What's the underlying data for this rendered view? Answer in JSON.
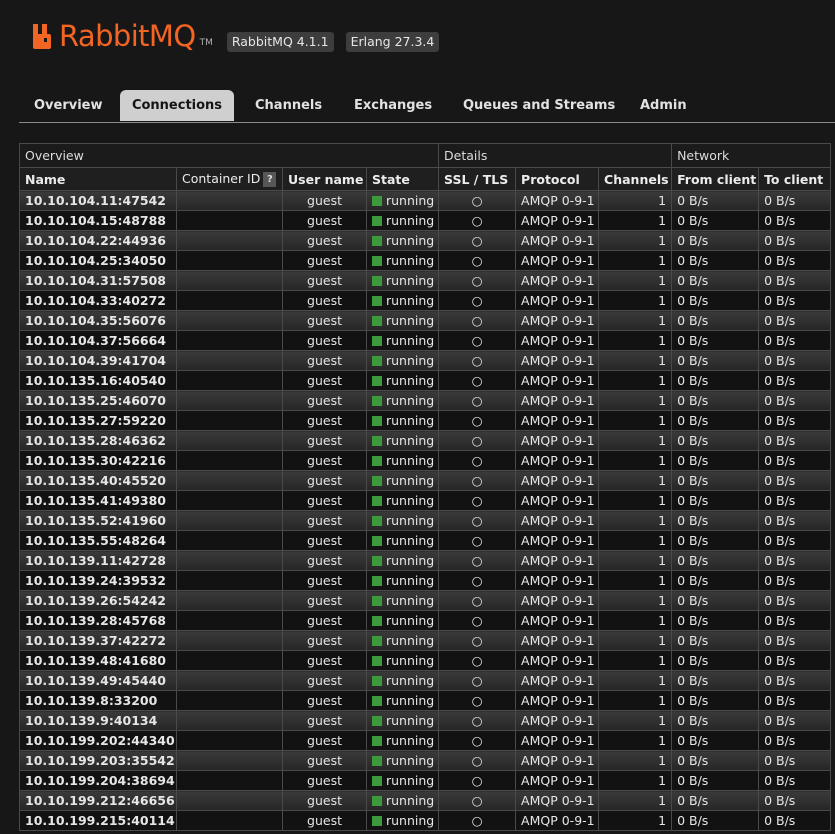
{
  "app": {
    "name": "RabbitMQ",
    "tm": "TM",
    "version_badge": "RabbitMQ 4.1.1",
    "erlang_badge": "Erlang 27.3.4",
    "brand_color": "#f26522"
  },
  "tabs": [
    {
      "label": "Overview",
      "active": false
    },
    {
      "label": "Connections",
      "active": true
    },
    {
      "label": "Channels",
      "active": false
    },
    {
      "label": "Exchanges",
      "active": false
    },
    {
      "label": "Queues and Streams",
      "active": false
    },
    {
      "label": "Admin",
      "active": false
    }
  ],
  "table": {
    "groups": [
      "Overview",
      "Details",
      "Network"
    ],
    "columns": [
      "Name",
      "Container ID",
      "User name",
      "State",
      "SSL / TLS",
      "Protocol",
      "Channels",
      "From client",
      "To client"
    ],
    "help_label": "?",
    "rows": [
      {
        "name": "10.10.104.11:47542",
        "user": "guest",
        "state": "running",
        "ssl": "○",
        "protocol": "AMQP 0-9-1",
        "channels": "1",
        "from": "0 B/s",
        "to": "0 B/s"
      },
      {
        "name": "10.10.104.15:48788",
        "user": "guest",
        "state": "running",
        "ssl": "○",
        "protocol": "AMQP 0-9-1",
        "channels": "1",
        "from": "0 B/s",
        "to": "0 B/s"
      },
      {
        "name": "10.10.104.22:44936",
        "user": "guest",
        "state": "running",
        "ssl": "○",
        "protocol": "AMQP 0-9-1",
        "channels": "1",
        "from": "0 B/s",
        "to": "0 B/s"
      },
      {
        "name": "10.10.104.25:34050",
        "user": "guest",
        "state": "running",
        "ssl": "○",
        "protocol": "AMQP 0-9-1",
        "channels": "1",
        "from": "0 B/s",
        "to": "0 B/s"
      },
      {
        "name": "10.10.104.31:57508",
        "user": "guest",
        "state": "running",
        "ssl": "○",
        "protocol": "AMQP 0-9-1",
        "channels": "1",
        "from": "0 B/s",
        "to": "0 B/s"
      },
      {
        "name": "10.10.104.33:40272",
        "user": "guest",
        "state": "running",
        "ssl": "○",
        "protocol": "AMQP 0-9-1",
        "channels": "1",
        "from": "0 B/s",
        "to": "0 B/s"
      },
      {
        "name": "10.10.104.35:56076",
        "user": "guest",
        "state": "running",
        "ssl": "○",
        "protocol": "AMQP 0-9-1",
        "channels": "1",
        "from": "0 B/s",
        "to": "0 B/s"
      },
      {
        "name": "10.10.104.37:56664",
        "user": "guest",
        "state": "running",
        "ssl": "○",
        "protocol": "AMQP 0-9-1",
        "channels": "1",
        "from": "0 B/s",
        "to": "0 B/s"
      },
      {
        "name": "10.10.104.39:41704",
        "user": "guest",
        "state": "running",
        "ssl": "○",
        "protocol": "AMQP 0-9-1",
        "channels": "1",
        "from": "0 B/s",
        "to": "0 B/s"
      },
      {
        "name": "10.10.135.16:40540",
        "user": "guest",
        "state": "running",
        "ssl": "○",
        "protocol": "AMQP 0-9-1",
        "channels": "1",
        "from": "0 B/s",
        "to": "0 B/s"
      },
      {
        "name": "10.10.135.25:46070",
        "user": "guest",
        "state": "running",
        "ssl": "○",
        "protocol": "AMQP 0-9-1",
        "channels": "1",
        "from": "0 B/s",
        "to": "0 B/s"
      },
      {
        "name": "10.10.135.27:59220",
        "user": "guest",
        "state": "running",
        "ssl": "○",
        "protocol": "AMQP 0-9-1",
        "channels": "1",
        "from": "0 B/s",
        "to": "0 B/s"
      },
      {
        "name": "10.10.135.28:46362",
        "user": "guest",
        "state": "running",
        "ssl": "○",
        "protocol": "AMQP 0-9-1",
        "channels": "1",
        "from": "0 B/s",
        "to": "0 B/s"
      },
      {
        "name": "10.10.135.30:42216",
        "user": "guest",
        "state": "running",
        "ssl": "○",
        "protocol": "AMQP 0-9-1",
        "channels": "1",
        "from": "0 B/s",
        "to": "0 B/s"
      },
      {
        "name": "10.10.135.40:45520",
        "user": "guest",
        "state": "running",
        "ssl": "○",
        "protocol": "AMQP 0-9-1",
        "channels": "1",
        "from": "0 B/s",
        "to": "0 B/s"
      },
      {
        "name": "10.10.135.41:49380",
        "user": "guest",
        "state": "running",
        "ssl": "○",
        "protocol": "AMQP 0-9-1",
        "channels": "1",
        "from": "0 B/s",
        "to": "0 B/s"
      },
      {
        "name": "10.10.135.52:41960",
        "user": "guest",
        "state": "running",
        "ssl": "○",
        "protocol": "AMQP 0-9-1",
        "channels": "1",
        "from": "0 B/s",
        "to": "0 B/s"
      },
      {
        "name": "10.10.135.55:48264",
        "user": "guest",
        "state": "running",
        "ssl": "○",
        "protocol": "AMQP 0-9-1",
        "channels": "1",
        "from": "0 B/s",
        "to": "0 B/s"
      },
      {
        "name": "10.10.139.11:42728",
        "user": "guest",
        "state": "running",
        "ssl": "○",
        "protocol": "AMQP 0-9-1",
        "channels": "1",
        "from": "0 B/s",
        "to": "0 B/s"
      },
      {
        "name": "10.10.139.24:39532",
        "user": "guest",
        "state": "running",
        "ssl": "○",
        "protocol": "AMQP 0-9-1",
        "channels": "1",
        "from": "0 B/s",
        "to": "0 B/s"
      },
      {
        "name": "10.10.139.26:54242",
        "user": "guest",
        "state": "running",
        "ssl": "○",
        "protocol": "AMQP 0-9-1",
        "channels": "1",
        "from": "0 B/s",
        "to": "0 B/s"
      },
      {
        "name": "10.10.139.28:45768",
        "user": "guest",
        "state": "running",
        "ssl": "○",
        "protocol": "AMQP 0-9-1",
        "channels": "1",
        "from": "0 B/s",
        "to": "0 B/s"
      },
      {
        "name": "10.10.139.37:42272",
        "user": "guest",
        "state": "running",
        "ssl": "○",
        "protocol": "AMQP 0-9-1",
        "channels": "1",
        "from": "0 B/s",
        "to": "0 B/s"
      },
      {
        "name": "10.10.139.48:41680",
        "user": "guest",
        "state": "running",
        "ssl": "○",
        "protocol": "AMQP 0-9-1",
        "channels": "1",
        "from": "0 B/s",
        "to": "0 B/s"
      },
      {
        "name": "10.10.139.49:45440",
        "user": "guest",
        "state": "running",
        "ssl": "○",
        "protocol": "AMQP 0-9-1",
        "channels": "1",
        "from": "0 B/s",
        "to": "0 B/s"
      },
      {
        "name": "10.10.139.8:33200",
        "user": "guest",
        "state": "running",
        "ssl": "○",
        "protocol": "AMQP 0-9-1",
        "channels": "1",
        "from": "0 B/s",
        "to": "0 B/s"
      },
      {
        "name": "10.10.139.9:40134",
        "user": "guest",
        "state": "running",
        "ssl": "○",
        "protocol": "AMQP 0-9-1",
        "channels": "1",
        "from": "0 B/s",
        "to": "0 B/s"
      },
      {
        "name": "10.10.199.202:44340",
        "user": "guest",
        "state": "running",
        "ssl": "○",
        "protocol": "AMQP 0-9-1",
        "channels": "1",
        "from": "0 B/s",
        "to": "0 B/s"
      },
      {
        "name": "10.10.199.203:35542",
        "user": "guest",
        "state": "running",
        "ssl": "○",
        "protocol": "AMQP 0-9-1",
        "channels": "1",
        "from": "0 B/s",
        "to": "0 B/s"
      },
      {
        "name": "10.10.199.204:38694",
        "user": "guest",
        "state": "running",
        "ssl": "○",
        "protocol": "AMQP 0-9-1",
        "channels": "1",
        "from": "0 B/s",
        "to": "0 B/s"
      },
      {
        "name": "10.10.199.212:46656",
        "user": "guest",
        "state": "running",
        "ssl": "○",
        "protocol": "AMQP 0-9-1",
        "channels": "1",
        "from": "0 B/s",
        "to": "0 B/s"
      },
      {
        "name": "10.10.199.215:40114",
        "user": "guest",
        "state": "running",
        "ssl": "○",
        "protocol": "AMQP 0-9-1",
        "channels": "1",
        "from": "0 B/s",
        "to": "0 B/s"
      }
    ]
  }
}
